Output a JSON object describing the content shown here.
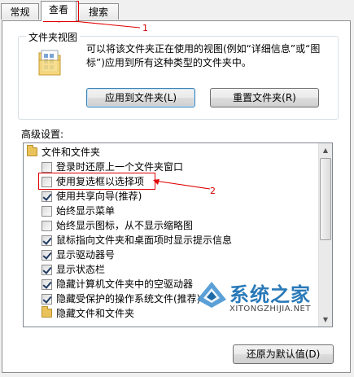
{
  "tabs": [
    "常规",
    "查看",
    "搜索"
  ],
  "folder_views": {
    "title": "文件夹视图",
    "description": "可以将该文件夹正在使用的视图(例如“详细信息”或“图标”)应用到所有这种类型的文件夹中。",
    "apply_button": "应用到文件夹(L)",
    "reset_button": "重置文件夹(R)"
  },
  "advanced": {
    "title": "高级设置:",
    "items": [
      {
        "type": "folder",
        "label": "文件和文件夹"
      },
      {
        "type": "checkbox",
        "label": "登录时还原上一个文件夹窗口",
        "checked": false
      },
      {
        "type": "checkbox",
        "label": "使用复选框以选择项",
        "checked": false
      },
      {
        "type": "checkbox",
        "label": "使用共享向导(推荐)",
        "checked": true
      },
      {
        "type": "checkbox",
        "label": "始终显示菜单",
        "checked": false
      },
      {
        "type": "checkbox",
        "label": "始终显示图标，从不显示缩略图",
        "checked": false
      },
      {
        "type": "checkbox",
        "label": "鼠标指向文件夹和桌面项时显示提示信息",
        "checked": true
      },
      {
        "type": "checkbox",
        "label": "显示驱动器号",
        "checked": true
      },
      {
        "type": "checkbox",
        "label": "显示状态栏",
        "checked": true
      },
      {
        "type": "checkbox",
        "label": "隐藏计算机文件夹中的空驱动器",
        "checked": true
      },
      {
        "type": "checkbox",
        "label": "隐藏受保护的操作系统文件(推荐)",
        "checked": true
      },
      {
        "type": "folder",
        "label": "隐藏文件和文件夹"
      }
    ],
    "restore_button": "还原为默认值(D)"
  },
  "annotations": {
    "marker_1": "1",
    "marker_2": "2"
  },
  "watermark": {
    "text": "系统之家",
    "url": "XITONGZHIJIA.NET"
  },
  "colors": {
    "annotation": "#e00000",
    "checkmark": "#1f3a63",
    "watermark": "#2a7ab8"
  }
}
